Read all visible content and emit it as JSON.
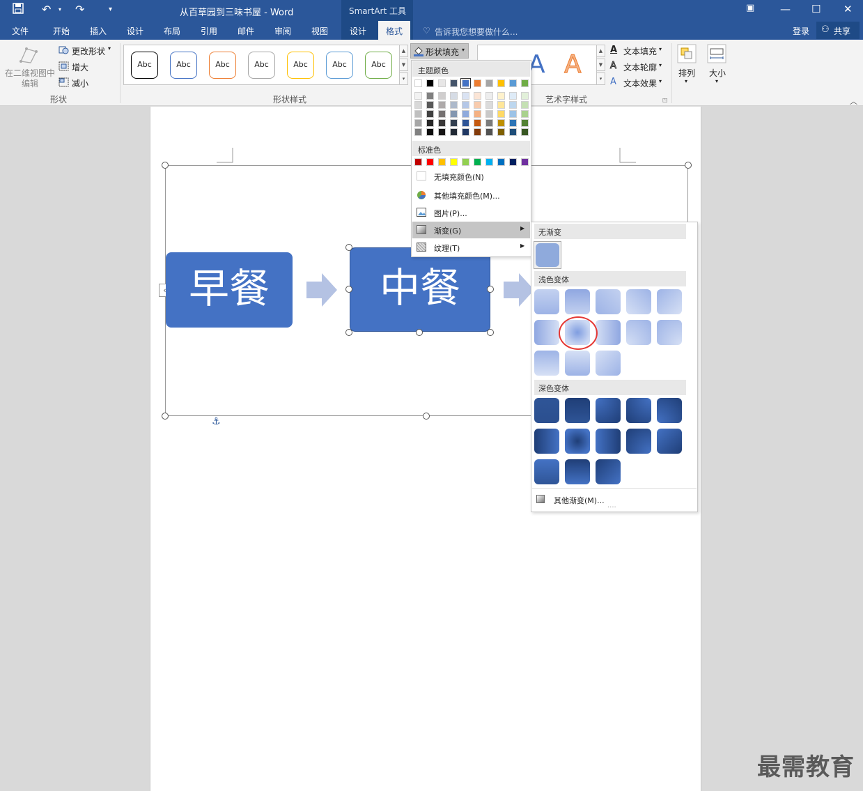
{
  "titlebar": {
    "doc_title": "从百草园到三味书屋 - Word",
    "context_tab": "SmartArt 工具"
  },
  "tabs": [
    {
      "label": "文件"
    },
    {
      "label": "开始"
    },
    {
      "label": "插入"
    },
    {
      "label": "设计"
    },
    {
      "label": "布局"
    },
    {
      "label": "引用"
    },
    {
      "label": "邮件"
    },
    {
      "label": "审阅"
    },
    {
      "label": "视图"
    },
    {
      "label": "设计"
    },
    {
      "label": "格式"
    }
  ],
  "tell_me": "告诉我您想要做什么...",
  "account": {
    "login": "登录",
    "share": "共享"
  },
  "ribbon": {
    "shapes_group": {
      "edit_2d": "在二维视图中编辑",
      "change_shape": "更改形状",
      "larger": "增大",
      "smaller": "减小",
      "name": "形状"
    },
    "styles_group": {
      "abc": "Abc",
      "name": "形状样式"
    },
    "shape_fill": "形状填充",
    "wordart": {
      "text_fill": "文本填充",
      "text_outline": "文本轮廓",
      "text_effect": "文本效果",
      "name": "艺术字样式",
      "sample": "A"
    },
    "arrange": "排列",
    "size": "大小"
  },
  "colors": {
    "theme_top": [
      "#ffffff",
      "#000000",
      "#e7e6e6",
      "#44546a",
      "#4472c4",
      "#ed7d31",
      "#a5a5a5",
      "#ffc000",
      "#5b9bd5",
      "#70ad47"
    ],
    "theme_cols": [
      [
        "#f2f2f2",
        "#d9d9d9",
        "#bfbfbf",
        "#a6a6a6",
        "#808080"
      ],
      [
        "#808080",
        "#595959",
        "#404040",
        "#262626",
        "#0d0d0d"
      ],
      [
        "#d0cece",
        "#aeaaaa",
        "#757171",
        "#3a3838",
        "#171616"
      ],
      [
        "#d6dce5",
        "#adb9ca",
        "#8497b0",
        "#333f50",
        "#222a35"
      ],
      [
        "#dae3f3",
        "#b4c7e7",
        "#8faadc",
        "#2f5597",
        "#203864"
      ],
      [
        "#fbe5d6",
        "#f8cbad",
        "#f4b183",
        "#c55a11",
        "#843c0c"
      ],
      [
        "#ededed",
        "#dbdbdb",
        "#c9c9c9",
        "#7b7b7b",
        "#525252"
      ],
      [
        "#fff2cc",
        "#ffe699",
        "#ffd966",
        "#bf9000",
        "#7f6000"
      ],
      [
        "#deebf7",
        "#bdd7ee",
        "#9dc3e6",
        "#2e75b6",
        "#1f4e79"
      ],
      [
        "#e2f0d9",
        "#c5e0b4",
        "#a9d18e",
        "#548235",
        "#385723"
      ]
    ],
    "standard": [
      "#c00000",
      "#ff0000",
      "#ffc000",
      "#ffff00",
      "#92d050",
      "#00b050",
      "#00b0f0",
      "#0070c0",
      "#002060",
      "#7030a0"
    ]
  },
  "fill_menu": {
    "theme_colors": "主题颜色",
    "standard_colors": "标准色",
    "no_fill": "无填充颜色(N)",
    "more_colors": "其他填充颜色(M)...",
    "picture": "图片(P)...",
    "gradient": "渐变(G)",
    "texture": "纹理(T)"
  },
  "gradient_menu": {
    "no_gradient": "无渐变",
    "light": "浅色变体",
    "dark": "深色变体",
    "more": "其他渐变(M)...",
    "more_dots": "...."
  },
  "smartart": {
    "box1": "早餐",
    "box2": "中餐"
  },
  "watermark": "最需教育"
}
